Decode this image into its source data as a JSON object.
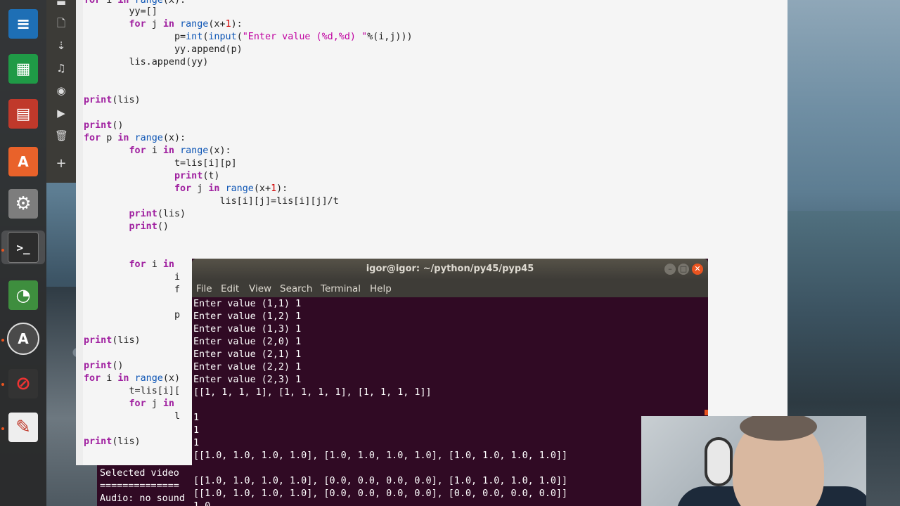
{
  "editor": {
    "lines": [
      {
        "y": -8,
        "html_key": "l0"
      },
      {
        "y": 10
      },
      {
        "y": 28
      }
    ],
    "code": {
      "l_yy": "        yy=[]",
      "l_forj": [
        "        ",
        "for",
        " j ",
        "in",
        " ",
        "range",
        "(x+",
        "1",
        "):"
      ],
      "l_p": [
        "                p=",
        "int",
        "(",
        "input",
        "(",
        "\"Enter value (%d,%d) \"",
        "%(i,j)))"
      ],
      "l_append": "                yy.append(p)",
      "l_lisappend": "        lis.append(yy)",
      "l_print1": [
        "print",
        "(lis)"
      ],
      "l_print2": [
        "print",
        "()"
      ],
      "l_forp": [
        "for",
        " p ",
        "in",
        " ",
        "range",
        "(x):"
      ],
      "l_fori": [
        "        ",
        "for",
        " i ",
        "in",
        " ",
        "range",
        "(x):"
      ],
      "l_t": "                t=lis[i][p]",
      "l_printt": [
        "                ",
        "print",
        "(t)"
      ],
      "l_forj2": [
        "                ",
        "for",
        " j ",
        "in",
        " ",
        "range",
        "(x+",
        "1",
        "):"
      ],
      "l_lisij": "                        lis[i][j]=lis[i][j]/t",
      "l_printlis2": [
        "        ",
        "print",
        "(lis)"
      ],
      "l_print3": [
        "        ",
        "print",
        "()"
      ],
      "l_fori2": [
        "        ",
        "for",
        " i ",
        "in"
      ],
      "l_i": "                i",
      "l_f": "                f",
      "l_pp": "                p",
      "l_printlis3": [
        "print",
        "(lis)"
      ],
      "l_print4": [
        "print",
        "()"
      ],
      "l_fori3": [
        "for",
        " i ",
        "in",
        " ",
        "range",
        "(x)"
      ],
      "l_tlis": "        t=lis[i][",
      "l_forj3": [
        "        ",
        "for",
        " j ",
        "in"
      ],
      "l_l": "                l",
      "l_printlis4": [
        "print",
        "(lis)"
      ],
      "l_top": "for i in range(x):"
    }
  },
  "under_terminal": {
    "lines": [
      "Selected video",
      "==============",
      "Audio: no sound"
    ]
  },
  "terminal": {
    "title": "igor@igor: ~/python/py45/pyp45",
    "menu": [
      "File",
      "Edit",
      "View",
      "Search",
      "Terminal",
      "Help"
    ],
    "output": [
      "Enter value (1,1) 1",
      "Enter value (1,2) 1",
      "Enter value (1,3) 1",
      "Enter value (2,0) 1",
      "Enter value (2,1) 1",
      "Enter value (2,2) 1",
      "Enter value (2,3) 1",
      "[[1, 1, 1, 1], [1, 1, 1, 1], [1, 1, 1, 1]]",
      "",
      "1",
      "1",
      "1",
      "[[1.0, 1.0, 1.0, 1.0], [1.0, 1.0, 1.0, 1.0], [1.0, 1.0, 1.0, 1.0]]",
      "",
      "[[1.0, 1.0, 1.0, 1.0], [0.0, 0.0, 0.0, 0.0], [1.0, 1.0, 1.0, 1.0]]",
      "[[1.0, 1.0, 1.0, 1.0], [0.0, 0.0, 0.0, 0.0], [0.0, 0.0, 0.0, 0.0]]",
      "1.0"
    ]
  },
  "launcher": {
    "items": [
      {
        "name": "libreoffice-writer-icon",
        "color": "#1e6fb5",
        "glyph": "≡"
      },
      {
        "name": "libreoffice-calc-icon",
        "color": "#1f9a46",
        "glyph": "▦"
      },
      {
        "name": "libreoffice-impress-icon",
        "color": "#c0392b",
        "glyph": "▤"
      },
      {
        "name": "ubuntu-software-icon",
        "color": "#e9622a",
        "glyph": "A"
      },
      {
        "name": "system-settings-icon",
        "color": "#8a8a8a",
        "glyph": "⚙"
      },
      {
        "name": "terminal-icon",
        "color": "#2c2c2c",
        "glyph": ">_"
      },
      {
        "name": "disk-usage-icon",
        "color": "#3e8e3e",
        "glyph": "◔"
      },
      {
        "name": "software-updater-icon",
        "color": "#4a4a4a",
        "glyph": "A"
      },
      {
        "name": "screen-recorder-icon",
        "color": "#333333",
        "glyph": "⊘"
      },
      {
        "name": "text-editor-icon",
        "color": "#eeeeee",
        "glyph": "✎"
      }
    ]
  },
  "sidebar": {
    "icons": [
      "folder-icon",
      "file-icon",
      "download-icon",
      "music-icon",
      "camera-icon",
      "video-icon",
      "trash-icon",
      "plus-icon"
    ],
    "glyphs": [
      "▬",
      "🗋",
      "⇣",
      "♫",
      "◉",
      "▶",
      "🗑",
      "+"
    ]
  }
}
